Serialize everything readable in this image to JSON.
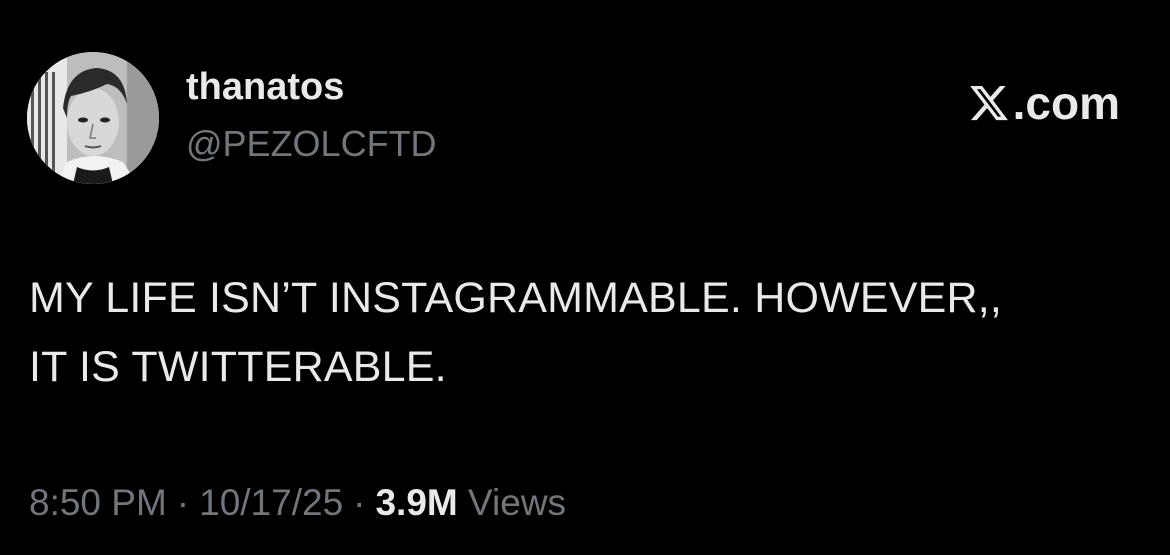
{
  "author": {
    "display_name": "thanatos",
    "handle": "@PEZOLCFTD",
    "avatar_icon": "profile-photo"
  },
  "brand": {
    "icon": "x-logo-icon",
    "text": ".com"
  },
  "tweet": {
    "lines": [
      "MY LIFE ISN’T INSTAGRAMMABLE. HOWEVER,,",
      "IT IS TWITTERABLE."
    ]
  },
  "meta": {
    "time": "8:50 PM",
    "date": "10/17/25",
    "separator": "·",
    "views_count": "3.9M",
    "views_label": "Views"
  },
  "colors": {
    "background": "#000000",
    "text_primary": "#e7e9ea",
    "text_secondary": "#71767b"
  }
}
